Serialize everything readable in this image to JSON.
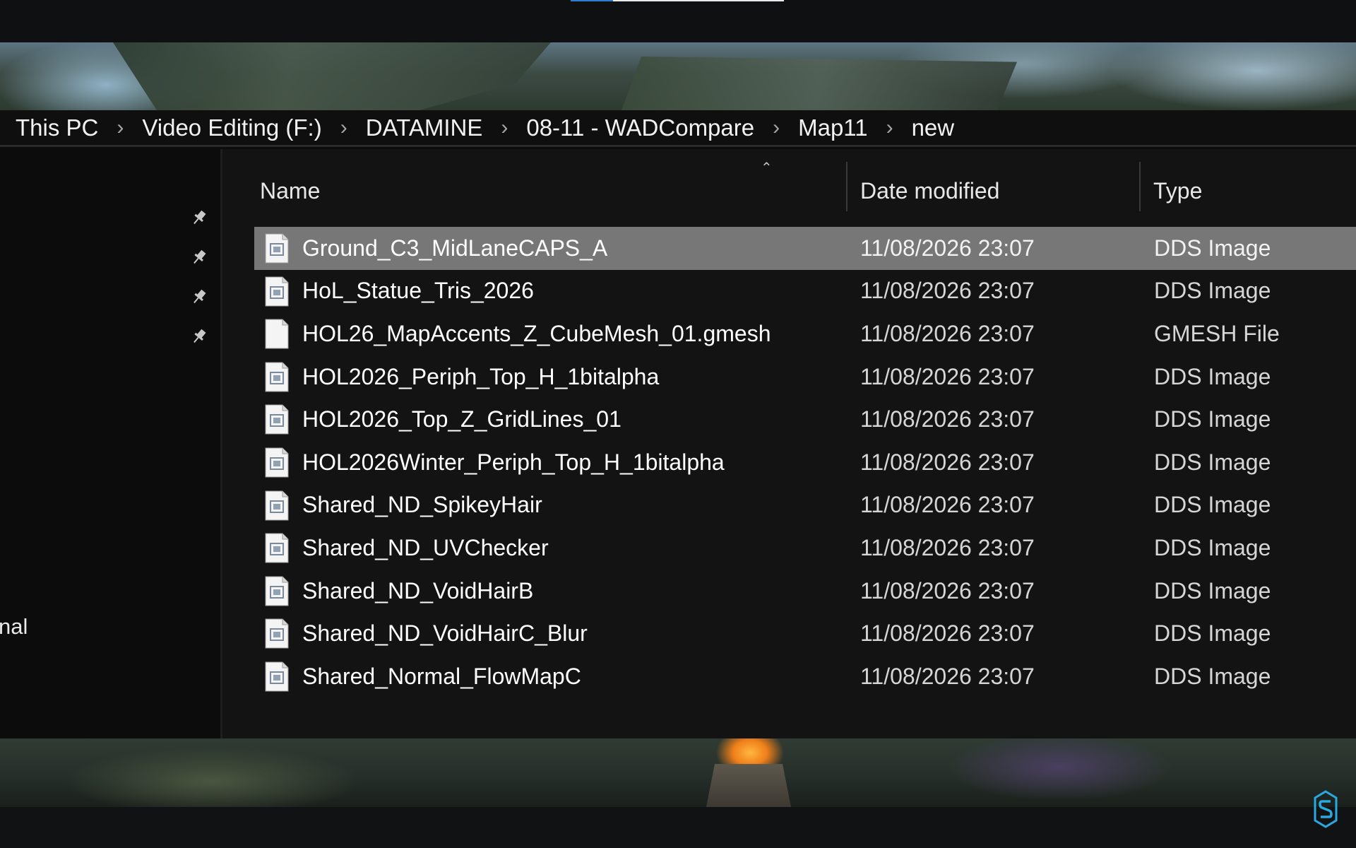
{
  "breadcrumb": [
    "This PC",
    "Video Editing (F:)",
    "DATAMINE",
    "08-11 - WADCompare",
    "Map11",
    "new"
  ],
  "nav": {
    "partial_label": "nal",
    "pinned_count": 4
  },
  "columns": {
    "name": "Name",
    "date": "Date modified",
    "type": "Type",
    "sort": "ascending"
  },
  "files": [
    {
      "name": "Ground_C3_MidLaneCAPS_A",
      "date": "11/08/2026 23:07",
      "type": "DDS Image",
      "icon": "image-file-icon",
      "selected": true
    },
    {
      "name": "HoL_Statue_Tris_2026",
      "date": "11/08/2026 23:07",
      "type": "DDS Image",
      "icon": "image-file-icon"
    },
    {
      "name": "HOL26_MapAccents_Z_CubeMesh_01.gmesh",
      "date": "11/08/2026 23:07",
      "type": "GMESH File",
      "icon": "blank-file-icon"
    },
    {
      "name": "HOL2026_Periph_Top_H_1bitalpha",
      "date": "11/08/2026 23:07",
      "type": "DDS Image",
      "icon": "image-file-icon"
    },
    {
      "name": "HOL2026_Top_Z_GridLines_01",
      "date": "11/08/2026 23:07",
      "type": "DDS Image",
      "icon": "image-file-icon"
    },
    {
      "name": "HOL2026Winter_Periph_Top_H_1bitalpha",
      "date": "11/08/2026 23:07",
      "type": "DDS Image",
      "icon": "image-file-icon"
    },
    {
      "name": "Shared_ND_SpikeyHair",
      "date": "11/08/2026 23:07",
      "type": "DDS Image",
      "icon": "image-file-icon"
    },
    {
      "name": "Shared_ND_UVChecker",
      "date": "11/08/2026 23:07",
      "type": "DDS Image",
      "icon": "image-file-icon"
    },
    {
      "name": "Shared_ND_VoidHairB",
      "date": "11/08/2026 23:07",
      "type": "DDS Image",
      "icon": "image-file-icon"
    },
    {
      "name": "Shared_ND_VoidHairC_Blur",
      "date": "11/08/2026 23:07",
      "type": "DDS Image",
      "icon": "image-file-icon"
    },
    {
      "name": "Shared_Normal_FlowMapC",
      "date": "11/08/2026 23:07",
      "type": "DDS Image",
      "icon": "image-file-icon"
    }
  ],
  "colors": {
    "selected_row": "#777777",
    "pane_bg": "#131313",
    "accent_logo": "#2aa8e0"
  }
}
